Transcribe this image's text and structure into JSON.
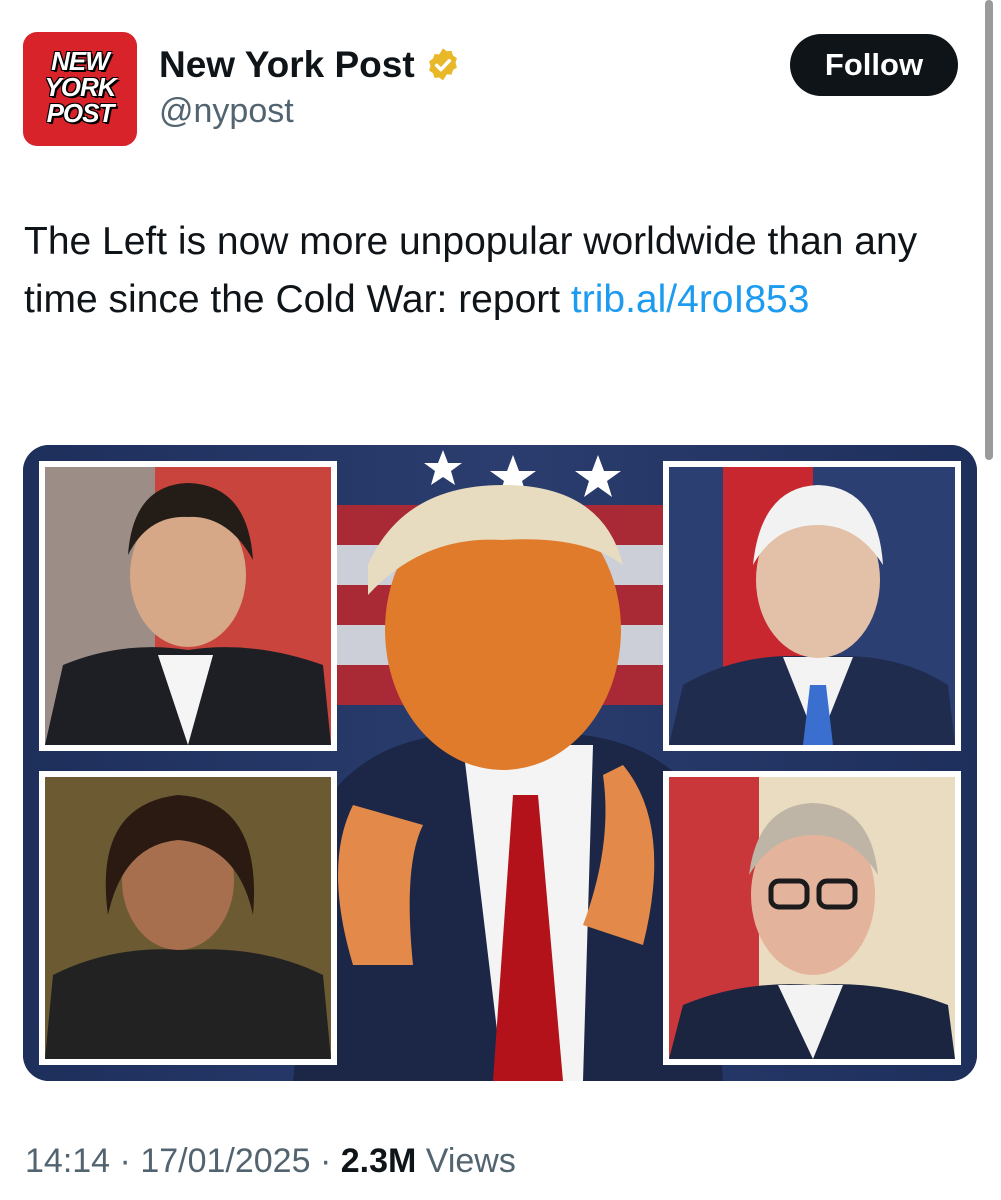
{
  "account": {
    "avatar_text_lines": [
      "NEW",
      "YORK",
      "POST"
    ],
    "name": "New York Post",
    "handle": "@nypost",
    "verified": true,
    "follow_label": "Follow"
  },
  "tweet": {
    "text": "The Left is now more unpopular worldwide than any time since the Cold War: report ",
    "link_text": "trib.al/​4roI853"
  },
  "media": {
    "panels": [
      "top-left-portrait",
      "top-right-portrait",
      "center-portrait",
      "bottom-left-portrait",
      "bottom-right-portrait"
    ]
  },
  "meta": {
    "time": "14:14",
    "date": "17/01/2025",
    "separator": "·",
    "views_count": "2.3M",
    "views_label": "Views"
  },
  "colors": {
    "brand_red": "#d8232a",
    "link_blue": "#1d9bf0",
    "text_secondary": "#536471",
    "verified_gold": "#e8b829"
  },
  "icons": [
    "verified-badge-icon"
  ]
}
